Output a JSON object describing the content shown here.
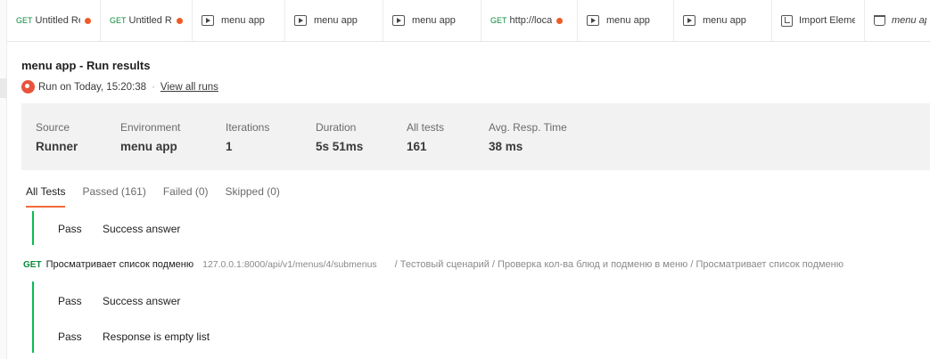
{
  "tabs": [
    {
      "kind": "request",
      "method": "GET",
      "title": "Untitled Re",
      "unsaved": true,
      "width": 105
    },
    {
      "kind": "request",
      "method": "GET",
      "title": "Untitled Re",
      "unsaved": true,
      "width": 103
    },
    {
      "kind": "runner",
      "title": "menu app",
      "width": 104
    },
    {
      "kind": "runner",
      "title": "menu app",
      "width": 110
    },
    {
      "kind": "runner",
      "title": "menu app",
      "width": 110
    },
    {
      "kind": "request",
      "method": "GET",
      "title": "http://loca",
      "unsaved": true,
      "width": 108
    },
    {
      "kind": "runner",
      "title": "menu app",
      "width": 108
    },
    {
      "kind": "runner",
      "title": "menu app",
      "width": 110
    },
    {
      "kind": "import",
      "title": "Import Eleme",
      "width": 104
    },
    {
      "kind": "collection",
      "title": "menu ap",
      "width": 80,
      "italic": true
    }
  ],
  "header": {
    "title": "menu app - Run results",
    "run_text": "Run on Today, 15:20:38",
    "separator": "·",
    "view_all_runs": "View all runs"
  },
  "stats": [
    {
      "label": "Source",
      "value": "Runner"
    },
    {
      "label": "Environment",
      "value": "menu app"
    },
    {
      "label": "Iterations",
      "value": "1"
    },
    {
      "label": "Duration",
      "value": "5s 51ms"
    },
    {
      "label": "All tests",
      "value": "161"
    },
    {
      "label": "Avg. Resp. Time",
      "value": "38 ms"
    }
  ],
  "filters": [
    {
      "label": "All Tests",
      "active": true
    },
    {
      "label": "Passed (161)",
      "active": false
    },
    {
      "label": "Failed (0)",
      "active": false
    },
    {
      "label": "Skipped (0)",
      "active": false
    }
  ],
  "results": {
    "first_group": [
      {
        "status": "Pass",
        "name": "Success answer"
      }
    ],
    "request": {
      "method": "GET",
      "name": "Просматривает список подменю",
      "url": "127.0.0.1:8000/api/v1/menus/4/submenus",
      "path": "/ Тестовый сценарий / Проверка кол-ва блюд и подменю в меню / Просматривает список подменю"
    },
    "second_group": [
      {
        "status": "Pass",
        "name": "Success answer"
      },
      {
        "status": "Pass",
        "name": "Response is empty list"
      }
    ]
  },
  "colors": {
    "accent": "#f26b3a",
    "pass_bar": "#0cbb52",
    "method_get": "#0a8a3a",
    "unsaved_dot": "#ef5b25"
  }
}
